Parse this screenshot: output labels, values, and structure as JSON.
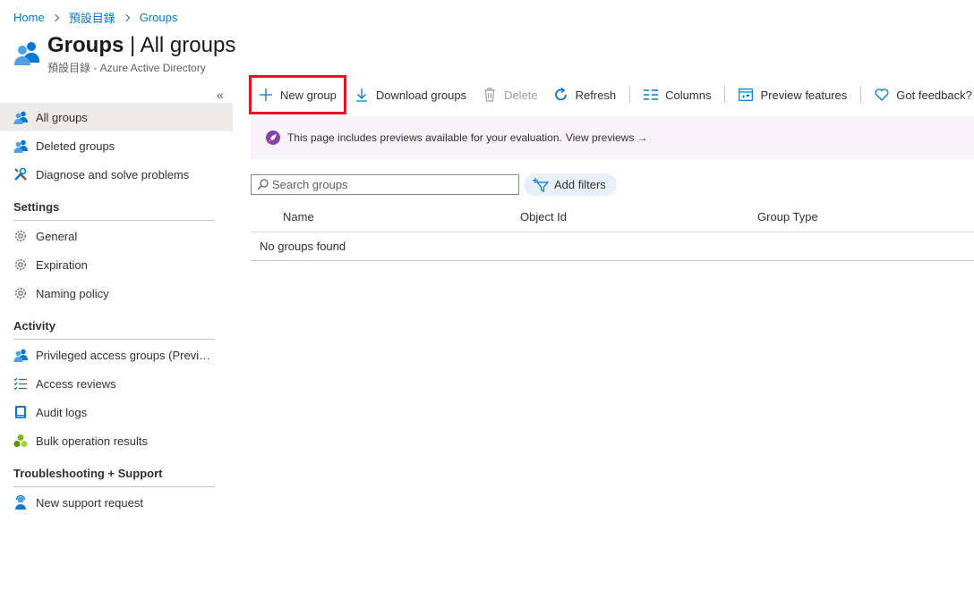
{
  "breadcrumb": {
    "home": "Home",
    "directory": "預設目錄",
    "current": "Groups"
  },
  "header": {
    "title_bold": "Groups",
    "title_rest": " | All groups",
    "subtitle": "預設目錄 - Azure Active Directory"
  },
  "sidebar": {
    "collapse_glyph": "«",
    "items": [
      {
        "label": "All groups",
        "icon": "users-icon",
        "active": true
      },
      {
        "label": "Deleted groups",
        "icon": "users-icon"
      },
      {
        "label": "Diagnose and solve problems",
        "icon": "wrench-icon"
      }
    ],
    "settings_title": "Settings",
    "settings": [
      {
        "label": "General",
        "icon": "gear-icon"
      },
      {
        "label": "Expiration",
        "icon": "gear-icon"
      },
      {
        "label": "Naming policy",
        "icon": "gear-icon"
      }
    ],
    "activity_title": "Activity",
    "activity": [
      {
        "label": "Privileged access groups (Preview)",
        "icon": "users-icon"
      },
      {
        "label": "Access reviews",
        "icon": "checklist-icon"
      },
      {
        "label": "Audit logs",
        "icon": "book-icon"
      },
      {
        "label": "Bulk operation results",
        "icon": "cluster-icon"
      }
    ],
    "support_title": "Troubleshooting + Support",
    "support": [
      {
        "label": "New support request",
        "icon": "support-user-icon"
      }
    ]
  },
  "toolbar": {
    "new_group": "New group",
    "download_groups": "Download groups",
    "delete": "Delete",
    "refresh": "Refresh",
    "columns": "Columns",
    "preview_features": "Preview features",
    "feedback": "Got feedback?"
  },
  "banner": {
    "text": "This page includes previews available for your evaluation.",
    "link": "View previews →"
  },
  "search": {
    "placeholder": "Search groups",
    "value": ""
  },
  "filters": {
    "add_label": "Add filters"
  },
  "table": {
    "columns": [
      "Name",
      "Object Id",
      "Group Type"
    ],
    "empty_message": "No groups found"
  },
  "colors": {
    "accent": "#0078d4",
    "highlight": "#e81123",
    "banner_bg": "#f8f3f9"
  }
}
